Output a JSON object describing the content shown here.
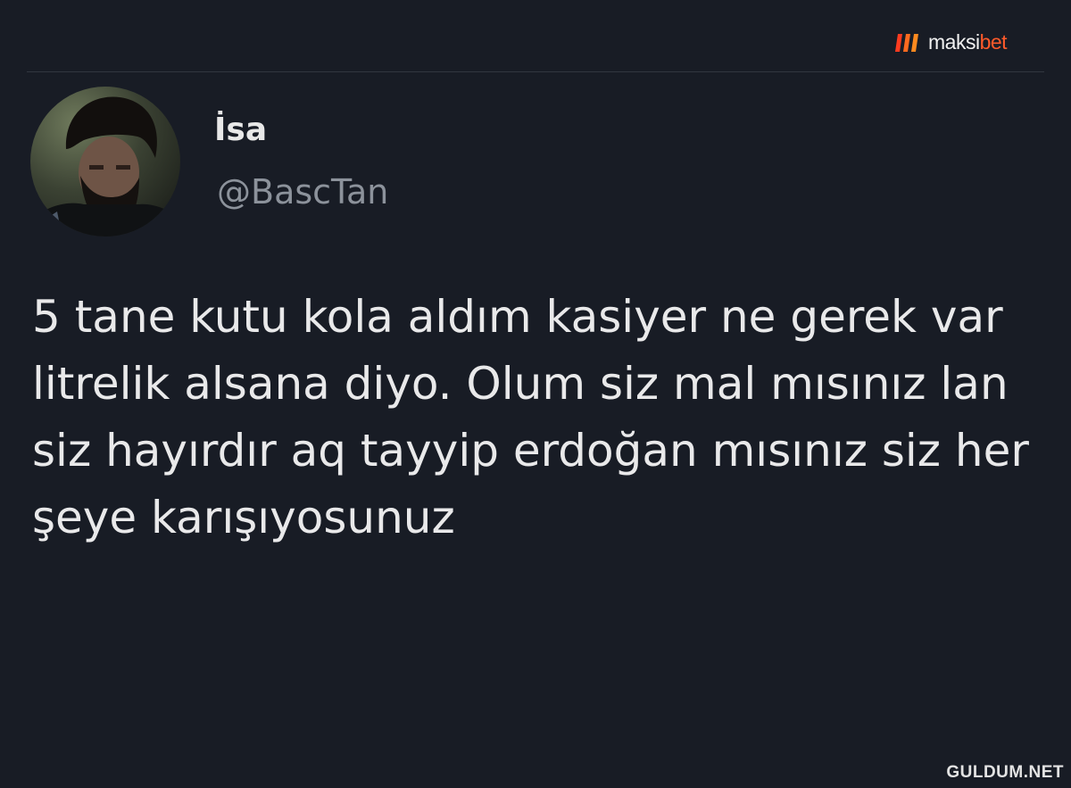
{
  "brand": {
    "name_part1": "maksi",
    "name_part2": "bet",
    "logo_icon": "maksibet-logo-icon",
    "accent_color": "#ff5a2a"
  },
  "tweet": {
    "avatar_icon": "profile-photo",
    "display_name": "İsa",
    "handle": "@BascTan",
    "text": "5 tane kutu kola aldım kasiyer ne gerek var litrelik alsana diyo. Olum siz mal mısınız lan siz hayırdır aq tayyip erdoğan mısınız siz her şeye karışıyosunuz",
    "background_color": "#181c25",
    "text_color": "#e9e9ea",
    "handle_color": "#8c929b"
  },
  "watermark": {
    "text": "GULDUM.NET"
  }
}
